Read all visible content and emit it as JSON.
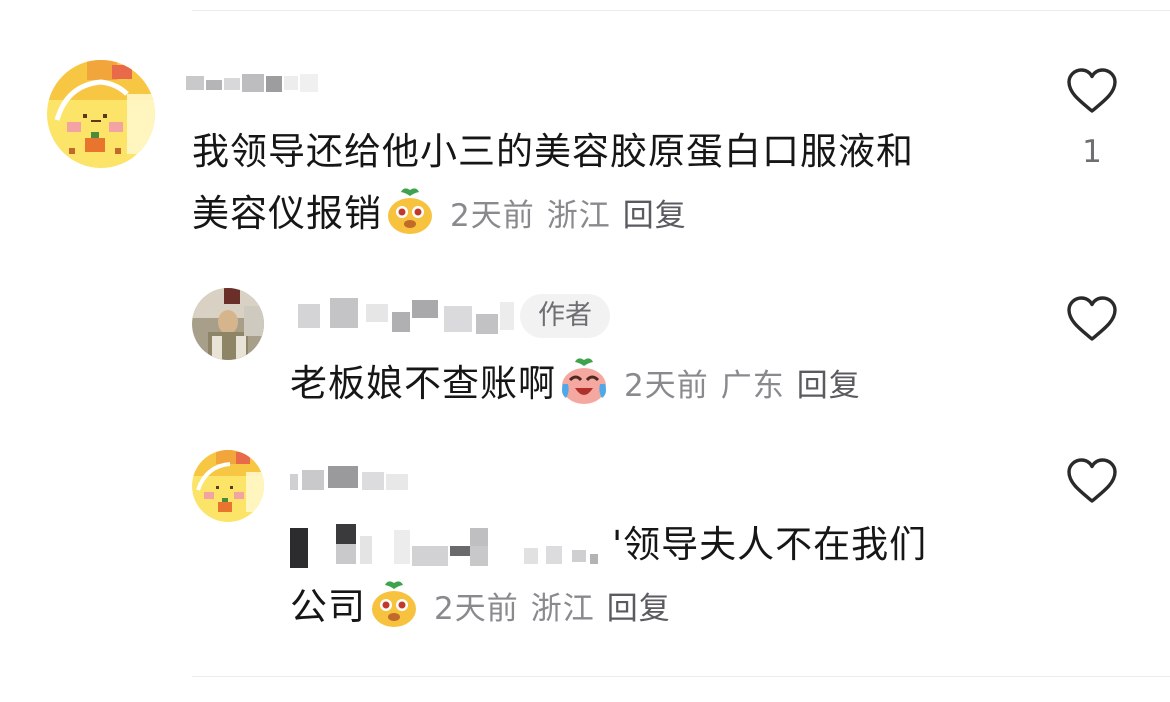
{
  "comments": [
    {
      "text_line1": "我领导还给他小三的美容胶原蛋白口服液和",
      "text_line2": "美容仪报销",
      "time": "2天前",
      "location": "浙江",
      "reply_label": "回复",
      "like_count": "1"
    },
    {
      "author_badge": "作者",
      "text": "老板娘不查账啊",
      "time": "2天前",
      "location": "广东",
      "reply_label": "回复"
    },
    {
      "text_line1_visible": "'领导夫人不在我们",
      "text_line2": "公司",
      "time": "2天前",
      "location": "浙江",
      "reply_label": "回复"
    }
  ],
  "icons": {
    "like": "heart-outline-icon",
    "emoji_smile": "sprout-face-emoji",
    "emoji_cry": "crying-laugh-emoji"
  },
  "colors": {
    "text": "#161616",
    "meta": "#8a8a8e",
    "heart": "#2a2a2a",
    "badge_bg": "#f2f2f3"
  }
}
